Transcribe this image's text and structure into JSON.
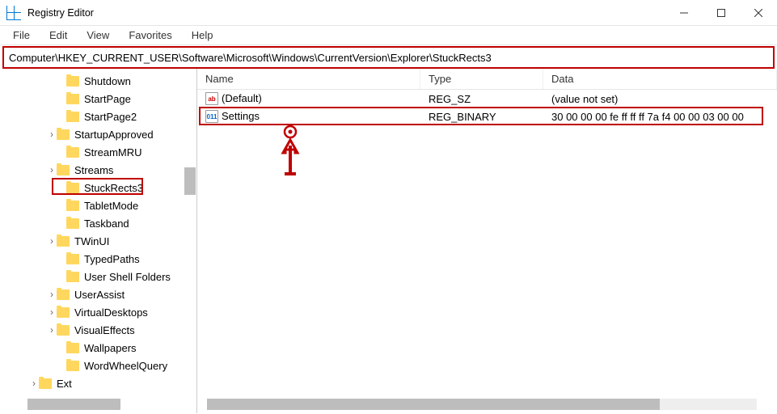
{
  "title": "Registry Editor",
  "menu": {
    "file": "File",
    "edit": "Edit",
    "view": "View",
    "favorites": "Favorites",
    "help": "Help"
  },
  "address": "Computer\\HKEY_CURRENT_USER\\Software\\Microsoft\\Windows\\CurrentVersion\\Explorer\\StuckRects3",
  "tree": [
    {
      "label": "Shutdown",
      "exp": "",
      "indent": 70
    },
    {
      "label": "StartPage",
      "exp": "",
      "indent": 70
    },
    {
      "label": "StartPage2",
      "exp": "",
      "indent": 70
    },
    {
      "label": "StartupApproved",
      "exp": "›",
      "indent": 58
    },
    {
      "label": "StreamMRU",
      "exp": "",
      "indent": 70
    },
    {
      "label": "Streams",
      "exp": "›",
      "indent": 58
    },
    {
      "label": "StuckRects3",
      "exp": "",
      "indent": 70,
      "selected": true
    },
    {
      "label": "TabletMode",
      "exp": "",
      "indent": 70
    },
    {
      "label": "Taskband",
      "exp": "",
      "indent": 70
    },
    {
      "label": "TWinUI",
      "exp": "›",
      "indent": 58
    },
    {
      "label": "TypedPaths",
      "exp": "",
      "indent": 70
    },
    {
      "label": "User Shell Folders",
      "exp": "",
      "indent": 70
    },
    {
      "label": "UserAssist",
      "exp": "›",
      "indent": 58
    },
    {
      "label": "VirtualDesktops",
      "exp": "›",
      "indent": 58
    },
    {
      "label": "VisualEffects",
      "exp": "›",
      "indent": 58
    },
    {
      "label": "Wallpapers",
      "exp": "",
      "indent": 70
    },
    {
      "label": "WordWheelQuery",
      "exp": "",
      "indent": 70
    },
    {
      "label": "Ext",
      "exp": "›",
      "indent": 36
    }
  ],
  "columns": {
    "name": "Name",
    "type": "Type",
    "data": "Data"
  },
  "values": [
    {
      "icon": "ab",
      "name": "(Default)",
      "type": "REG_SZ",
      "data": "(value not set)"
    },
    {
      "icon": "011",
      "name": "Settings",
      "type": "REG_BINARY",
      "data": "30 00 00 00 fe ff ff ff 7a f4 00 00 03 00 00"
    }
  ]
}
